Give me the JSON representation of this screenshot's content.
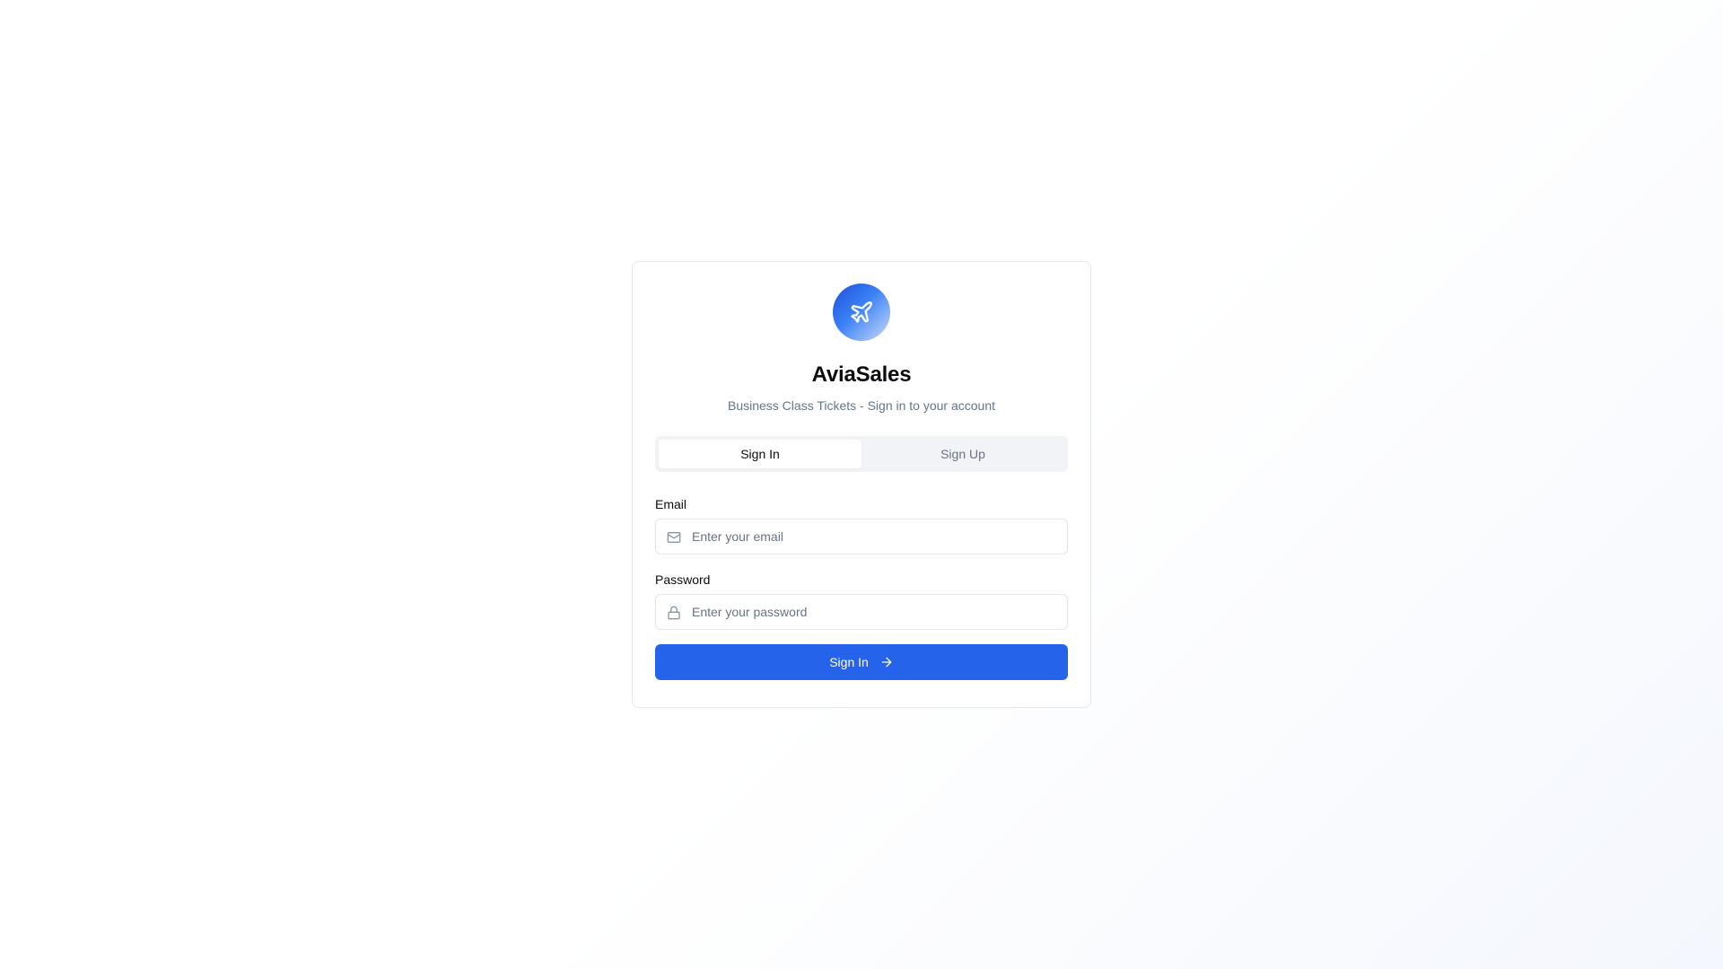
{
  "app": {
    "title": "AviaSales",
    "subtitle": "Business Class Tickets - Sign in to your account",
    "logo_icon": "airplane-icon"
  },
  "tabs": [
    {
      "label": "Sign In",
      "active": true
    },
    {
      "label": "Sign Up",
      "active": false
    }
  ],
  "form": {
    "email": {
      "label": "Email",
      "placeholder": "Enter your email",
      "value": "",
      "icon": "mail-icon"
    },
    "password": {
      "label": "Password",
      "placeholder": "Enter your password",
      "value": "",
      "icon": "lock-icon"
    },
    "submit": {
      "label": "Sign In",
      "icon": "arrow-right-icon"
    }
  },
  "colors": {
    "primary": "#2563eb",
    "muted_text": "#64748b",
    "tab_track": "#f1f3f6",
    "border": "#e5e7eb"
  }
}
